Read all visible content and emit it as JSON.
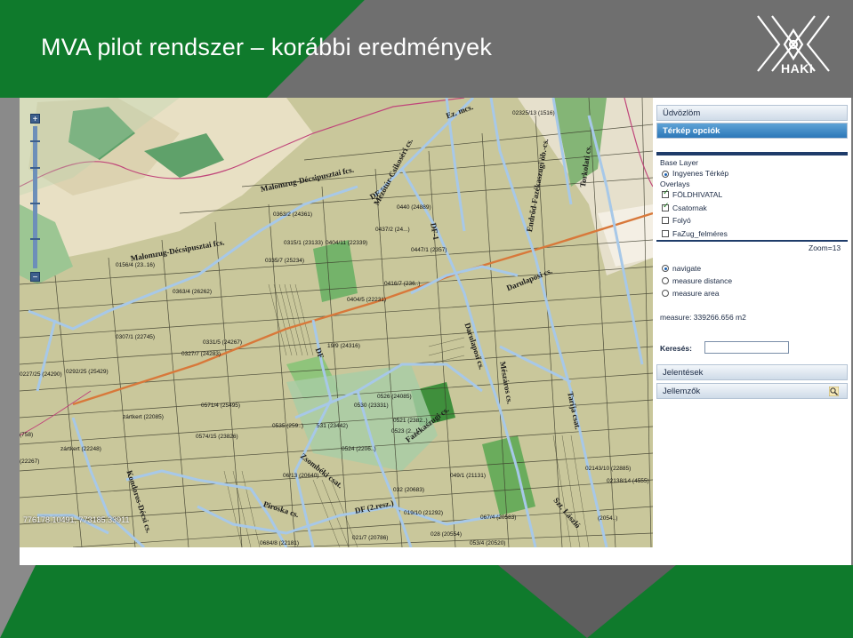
{
  "slide": {
    "title": "MVA pilot rendszer – korábbi eredmények",
    "logo_text": "HAKI",
    "colors": {
      "green": "#0f7a2c",
      "gray": "#7a7a7a"
    }
  },
  "map": {
    "coordinate_readout": "776178.10491, 773185.33911",
    "road_labels": [
      "Malomzug-Décsipusztai fcs.",
      "Malomzug-Décsipusztai fcs.",
      "Mezőtúr-Csikoséri cs.",
      "Endrőd-Fazékaszugi öb.-cs.",
      "Torkolati cs.",
      "Darulaposi cs.",
      "Darulaposi cs.",
      "Mészáros cs.",
      "Fazékaszugi cs.",
      "Zsombéki csat.",
      "Piroska cs.",
      "DF (2.resz.)",
      "Szt. László",
      "Kondoros-Décsi cs.",
      "Tarija csat.",
      "DF",
      "DF-1",
      "DF",
      "Ez. mcs."
    ],
    "parcel_labels": [
      "0363/2 (24361)",
      "0315/1 (23133)",
      "0404/11 (22339)",
      "0437/2 (24...)",
      "0440 (24889)",
      "0447/1 (2357)",
      "0335/7 (25234)",
      "0156/4 (23..16)",
      "0363/4 (26262)",
      "0416/7 (236..)",
      "0404/5 (22231)",
      "0307/1 (22745)",
      "0331/5 (24267)",
      "0327/7 (24283)",
      "19/9 (24316)",
      "0227/25 (24290)",
      "0292/25 (25429)",
      "0526 (24085)",
      "0530 (23331)",
      "0571/4 (25495)",
      "0521 (2382..)",
      "0523 (2...)",
      "zártkert (22085)",
      "0535 (259..)",
      "531 (23442)",
      "0574/15 (23826)",
      "0524 (2206..)",
      "zártkert (22248)",
      "(22267)",
      "06/13 (20640)",
      "032 (20683)",
      "049/1 (21131)",
      "019/10 (21292)",
      "067/4 (20583)",
      "028 (20554)",
      "021/7 (20786)",
      "053/4 (20520)",
      "0684/8 (22181)",
      "02143/10 (22885)",
      "02138/14 (4555)",
      "(2054..)",
      "02325/13 (1516)",
      "(758)"
    ]
  },
  "panel": {
    "welcome": "Üdvözlöm",
    "map_options": "Térkép opciók",
    "base_layer_label": "Base Layer",
    "base_layer_option": "Ingyenes Térkép",
    "overlays_label": "Overlays",
    "overlays": [
      {
        "label": "FÖLDHIVATAL",
        "checked": true
      },
      {
        "label": "Csatornak",
        "checked": true
      },
      {
        "label": "Folyó",
        "checked": false
      },
      {
        "label": "FaZug_felméres",
        "checked": false
      }
    ],
    "zoom": "Zoom=13",
    "tools": [
      {
        "label": "navigate",
        "selected": true
      },
      {
        "label": "measure distance",
        "selected": false
      },
      {
        "label": "measure area",
        "selected": false
      }
    ],
    "measure": "measure: 339266.656 m2",
    "search_label": "Keresés:",
    "search_value": "",
    "reports": "Jelentések",
    "features": "Jellemzők"
  }
}
